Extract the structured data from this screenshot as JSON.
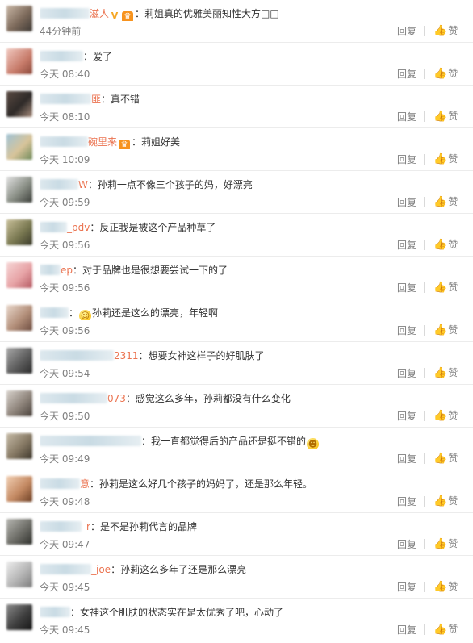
{
  "actions": {
    "reply": "回复",
    "like": "赞",
    "thumb_icon": "thumb-up-icon"
  },
  "comments": [
    {
      "name_visible": "滋人",
      "badges": [
        "v",
        "crown"
      ],
      "text": "：莉姐真的优雅美丽知性大方",
      "trail_boxes": "□□",
      "time": "44分钟前"
    },
    {
      "name_visible": "",
      "badges": [],
      "text": "：爱了",
      "time": "今天 08:40"
    },
    {
      "name_visible": "匪",
      "badges": [],
      "text": "：真不错",
      "time": "今天 08:10"
    },
    {
      "name_visible": "碗里来",
      "badges": [
        "crown"
      ],
      "text": "：莉姐好美",
      "time": "今天 10:09"
    },
    {
      "name_visible": "W",
      "badges": [],
      "text": "：孙莉一点不像三个孩子的妈，好漂亮",
      "time": "今天 09:59"
    },
    {
      "name_visible": "_pdv",
      "badges": [],
      "text": "：反正我是被这个产品种草了",
      "time": "今天 09:56"
    },
    {
      "name_visible": "ep",
      "badges": [],
      "text": "：对于品牌也是很想要尝试一下的了",
      "time": "今天 09:56"
    },
    {
      "name_visible": "",
      "badges": [],
      "text": "孙莉还是这么的漂亮，年轻啊",
      "lead_emoji": true,
      "time": "今天 09:56"
    },
    {
      "name_visible": "2311",
      "badges": [],
      "text": "：想要女神这样子的好肌肤了",
      "time": "今天 09:54"
    },
    {
      "name_visible": "073",
      "badges": [],
      "text": "：感觉这么多年，孙莉都没有什么变化",
      "time": "今天 09:50"
    },
    {
      "name_visible": "",
      "badges": [],
      "text": "：我一直都觉得后的产品还是挺不错的",
      "trail_emoji": true,
      "time": "今天 09:49"
    },
    {
      "name_visible": "意",
      "badges": [],
      "text": "：孙莉是这么好几个孩子的妈妈了，还是那么年轻。",
      "time": "今天 09:48"
    },
    {
      "name_visible": "_r",
      "badges": [],
      "text": "：是不是孙莉代言的品牌",
      "time": "今天 09:47"
    },
    {
      "name_visible": "_joe",
      "badges": [],
      "text": "：孙莉这么多年了还是那么漂亮",
      "time": "今天 09:45"
    },
    {
      "name_visible": "",
      "badges": [],
      "text": "：女神这个肌肤的状态实在是太优秀了吧，心动了",
      "time": "今天 09:45"
    }
  ]
}
